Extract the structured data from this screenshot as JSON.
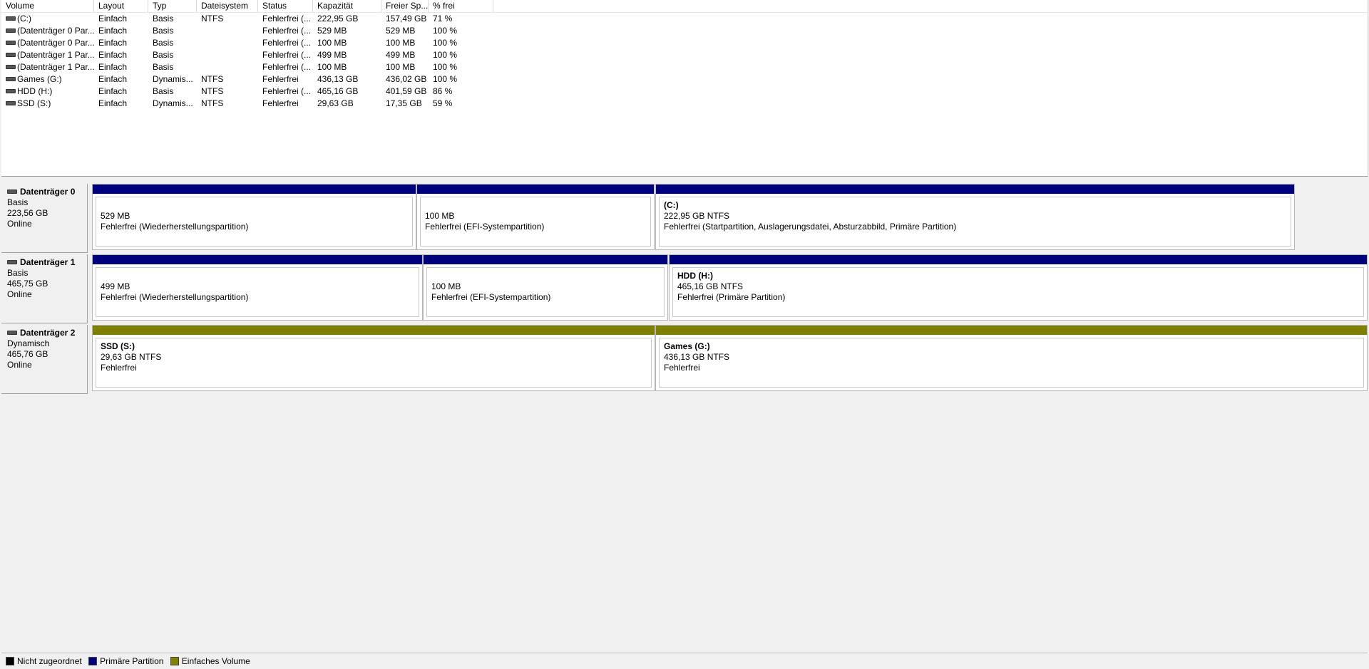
{
  "colors": {
    "unallocated": "#000000",
    "primary": "#00007d",
    "simple": "#808000"
  },
  "volume_list": {
    "columns": [
      "Volume",
      "Layout",
      "Typ",
      "Dateisystem",
      "Status",
      "Kapazität",
      "Freier Sp...",
      "% frei"
    ],
    "rows": [
      [
        "(C:)",
        "Einfach",
        "Basis",
        "NTFS",
        "Fehlerfrei (...",
        "222,95 GB",
        "157,49 GB",
        "71 %"
      ],
      [
        "(Datenträger 0 Par...",
        "Einfach",
        "Basis",
        "",
        "Fehlerfrei (...",
        "529 MB",
        "529 MB",
        "100 %"
      ],
      [
        "(Datenträger 0 Par...",
        "Einfach",
        "Basis",
        "",
        "Fehlerfrei (...",
        "100 MB",
        "100 MB",
        "100 %"
      ],
      [
        "(Datenträger 1 Par...",
        "Einfach",
        "Basis",
        "",
        "Fehlerfrei (...",
        "499 MB",
        "499 MB",
        "100 %"
      ],
      [
        "(Datenträger 1 Par...",
        "Einfach",
        "Basis",
        "",
        "Fehlerfrei (...",
        "100 MB",
        "100 MB",
        "100 %"
      ],
      [
        "Games (G:)",
        "Einfach",
        "Dynamis...",
        "NTFS",
        "Fehlerfrei",
        "436,13 GB",
        "436,02 GB",
        "100 %"
      ],
      [
        "HDD (H:)",
        "Einfach",
        "Basis",
        "NTFS",
        "Fehlerfrei (...",
        "465,16 GB",
        "401,59 GB",
        "86 %"
      ],
      [
        "SSD (S:)",
        "Einfach",
        "Dynamis...",
        "NTFS",
        "Fehlerfrei",
        "29,63 GB",
        "17,35 GB",
        "59 %"
      ]
    ]
  },
  "disks": [
    {
      "name": "Datenträger 0",
      "type": "Basis",
      "size": "223,56 GB",
      "state": "Online",
      "partitions": [
        {
          "label": "",
          "size": "529 MB",
          "status": "Fehlerfrei (Wiederherstellungspartition)",
          "kind": "primary"
        },
        {
          "label": "",
          "size": "100 MB",
          "status": "Fehlerfrei (EFI-Systempartition)",
          "kind": "primary"
        },
        {
          "label": "(C:)",
          "size": "222,95 GB NTFS",
          "status": "Fehlerfrei (Startpartition, Auslagerungsdatei, Absturzabbild, Primäre Partition)",
          "kind": "primary"
        }
      ]
    },
    {
      "name": "Datenträger 1",
      "type": "Basis",
      "size": "465,75 GB",
      "state": "Online",
      "partitions": [
        {
          "label": "",
          "size": "499 MB",
          "status": "Fehlerfrei (Wiederherstellungspartition)",
          "kind": "primary"
        },
        {
          "label": "",
          "size": "100 MB",
          "status": "Fehlerfrei (EFI-Systempartition)",
          "kind": "primary"
        },
        {
          "label": "HDD  (H:)",
          "size": "465,16 GB NTFS",
          "status": "Fehlerfrei (Primäre Partition)",
          "kind": "primary"
        }
      ]
    },
    {
      "name": "Datenträger 2",
      "type": "Dynamisch",
      "size": "465,76 GB",
      "state": "Online",
      "partitions": [
        {
          "label": "SSD  (S:)",
          "size": "29,63 GB NTFS",
          "status": "Fehlerfrei",
          "kind": "simple"
        },
        {
          "label": "Games  (G:)",
          "size": "436,13 GB NTFS",
          "status": "Fehlerfrei",
          "kind": "simple"
        }
      ]
    }
  ],
  "legend": [
    {
      "label": "Nicht zugeordnet",
      "kind": "unallocated"
    },
    {
      "label": "Primäre Partition",
      "kind": "primary"
    },
    {
      "label": "Einfaches Volume",
      "kind": "simple"
    }
  ]
}
